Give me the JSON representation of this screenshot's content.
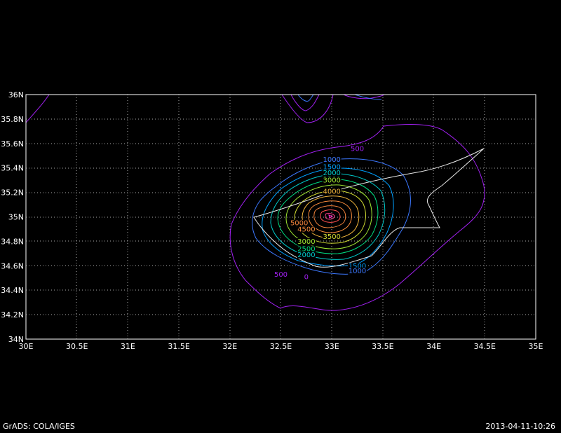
{
  "chart_data": {
    "type": "contour-map",
    "x_ticks": [
      "30E",
      "30.5E",
      "31E",
      "31.5E",
      "32E",
      "32.5E",
      "33E",
      "33.5E",
      "34E",
      "34.5E",
      "35E"
    ],
    "y_ticks": [
      "34N",
      "34.2N",
      "34.4N",
      "34.6N",
      "34.8N",
      "35N",
      "35.2N",
      "35.4N",
      "35.6N",
      "35.8N",
      "36N"
    ],
    "xlim": [
      30,
      35
    ],
    "ylim": [
      34,
      36
    ],
    "grid": true,
    "contour_labels": [
      {
        "text": "500",
        "lon": 33.25,
        "lat": 35.54,
        "color": "#a020f0"
      },
      {
        "text": "1000",
        "lon": 33.0,
        "lat": 35.45,
        "color": "#3c78ff"
      },
      {
        "text": "1500",
        "lon": 33.0,
        "lat": 35.39,
        "color": "#00a0ff"
      },
      {
        "text": "2000",
        "lon": 33.0,
        "lat": 35.34,
        "color": "#00c8c8"
      },
      {
        "text": "2500",
        "lon": 33.0,
        "lat": 35.29,
        "color": "#00dc82"
      },
      {
        "text": "3000",
        "lon": 33.0,
        "lat": 35.28,
        "color": "#a0e632"
      },
      {
        "text": "4000",
        "lon": 33.0,
        "lat": 35.19,
        "color": "#f0b43c"
      },
      {
        "text": "4500",
        "lon": 32.75,
        "lat": 34.88,
        "color": "#fa8c3c"
      },
      {
        "text": "5000",
        "lon": 32.68,
        "lat": 34.93,
        "color": "#f0823c"
      },
      {
        "text": "3500",
        "lon": 33.0,
        "lat": 34.82,
        "color": "#d2dc32"
      },
      {
        "text": "3000",
        "lon": 32.75,
        "lat": 34.78,
        "color": "#a0e632"
      },
      {
        "text": "2500",
        "lon": 32.75,
        "lat": 34.72,
        "color": "#00dc82"
      },
      {
        "text": "2000",
        "lon": 32.75,
        "lat": 34.67,
        "color": "#00c8c8"
      },
      {
        "text": "1500",
        "lon": 33.25,
        "lat": 34.58,
        "color": "#00a0ff"
      },
      {
        "text": "1000",
        "lon": 33.25,
        "lat": 34.54,
        "color": "#3c78ff"
      },
      {
        "text": "500",
        "lon": 32.5,
        "lat": 34.51,
        "color": "#a020f0"
      },
      {
        "text": "0",
        "lon": 32.75,
        "lat": 34.49,
        "color": "#a020f0"
      }
    ]
  },
  "footer": {
    "left": "GrADS: COLA/IGES",
    "right": "2013-04-11-10:26"
  }
}
